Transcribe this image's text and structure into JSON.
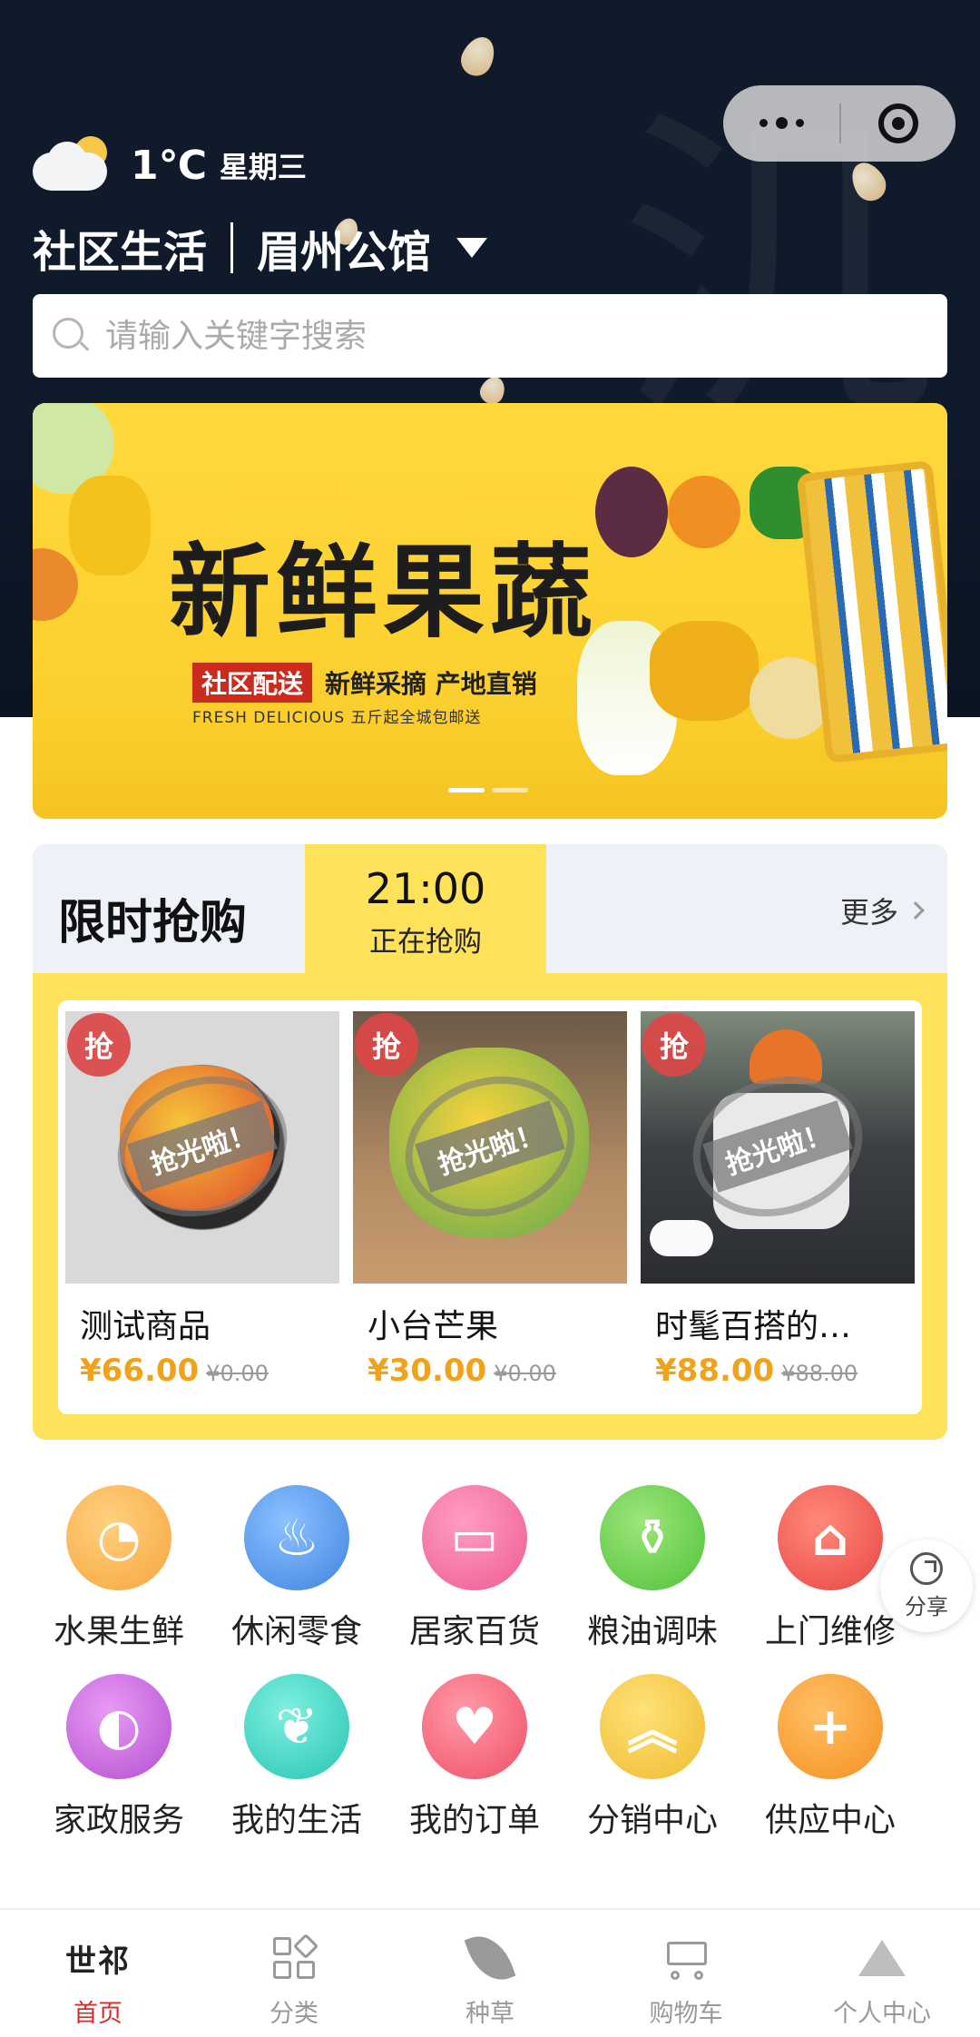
{
  "header": {
    "temperature": "1℃",
    "weekday": "星期三",
    "community_label": "社区生活",
    "community_name": "眉州公馆"
  },
  "search": {
    "placeholder": "请输入关键字搜索"
  },
  "banner": {
    "headline": "新鲜果蔬",
    "chip": "社区配送",
    "tagline": "新鲜采摘 产地直销",
    "subline": "FRESH   DELICIOUS   五斤起全城包邮送",
    "slide_count": 2,
    "active_slide": 1
  },
  "flash_sale": {
    "title": "限时抢购",
    "slot_time": "21:00",
    "slot_state": "正在抢购",
    "more_label": "更多",
    "badge_text": "抢",
    "soldout_text": "抢光啦！",
    "products": [
      {
        "name": "测试商品",
        "price": "¥66.00",
        "original_price": "¥0.00"
      },
      {
        "name": "小台芒果",
        "price": "¥30.00",
        "original_price": "¥0.00"
      },
      {
        "name": "时髦百搭的…",
        "price": "¥88.00",
        "original_price": "¥88.00"
      }
    ]
  },
  "categories": [
    {
      "label": "水果生鲜",
      "icon": "orange-icon",
      "color": "#f7a63b"
    },
    {
      "label": "休闲零食",
      "icon": "cupcake-icon",
      "color": "#4a8fe7"
    },
    {
      "label": "居家百货",
      "icon": "tissue-icon",
      "color": "#f2689b"
    },
    {
      "label": "粮油调味",
      "icon": "bottles-icon",
      "color": "#5cc93d"
    },
    {
      "label": "上门维修",
      "icon": "house-wrench-icon",
      "color": "#ee4d4d"
    },
    {
      "label": "家政服务",
      "icon": "vacuum-icon",
      "color": "#c35ad8"
    },
    {
      "label": "我的生活",
      "icon": "leaf-icon",
      "color": "#36cfc0"
    },
    {
      "label": "我的订单",
      "icon": "heart-icon",
      "color": "#f25a6e"
    },
    {
      "label": "分销中心",
      "icon": "chevrons-up-icon",
      "color": "#f2c13b"
    },
    {
      "label": "供应中心",
      "icon": "plus-icon",
      "color": "#f79a2a"
    }
  ],
  "share": {
    "label": "分享"
  },
  "tabbar": {
    "items": [
      {
        "label": "首页",
        "icon": "brand-logo-icon",
        "active": true
      },
      {
        "label": "分类",
        "icon": "grid-icon",
        "active": false
      },
      {
        "label": "种草",
        "icon": "leaf-icon",
        "active": false
      },
      {
        "label": "购物车",
        "icon": "cart-icon",
        "active": false
      },
      {
        "label": "个人中心",
        "icon": "crown-icon",
        "active": false
      }
    ],
    "logo_text": "世祁"
  },
  "colors": {
    "accent_yellow": "#fde25a",
    "price_orange": "#f0a21a",
    "active_tab": "#d72c2c",
    "hero_dark": "#101a2a"
  }
}
